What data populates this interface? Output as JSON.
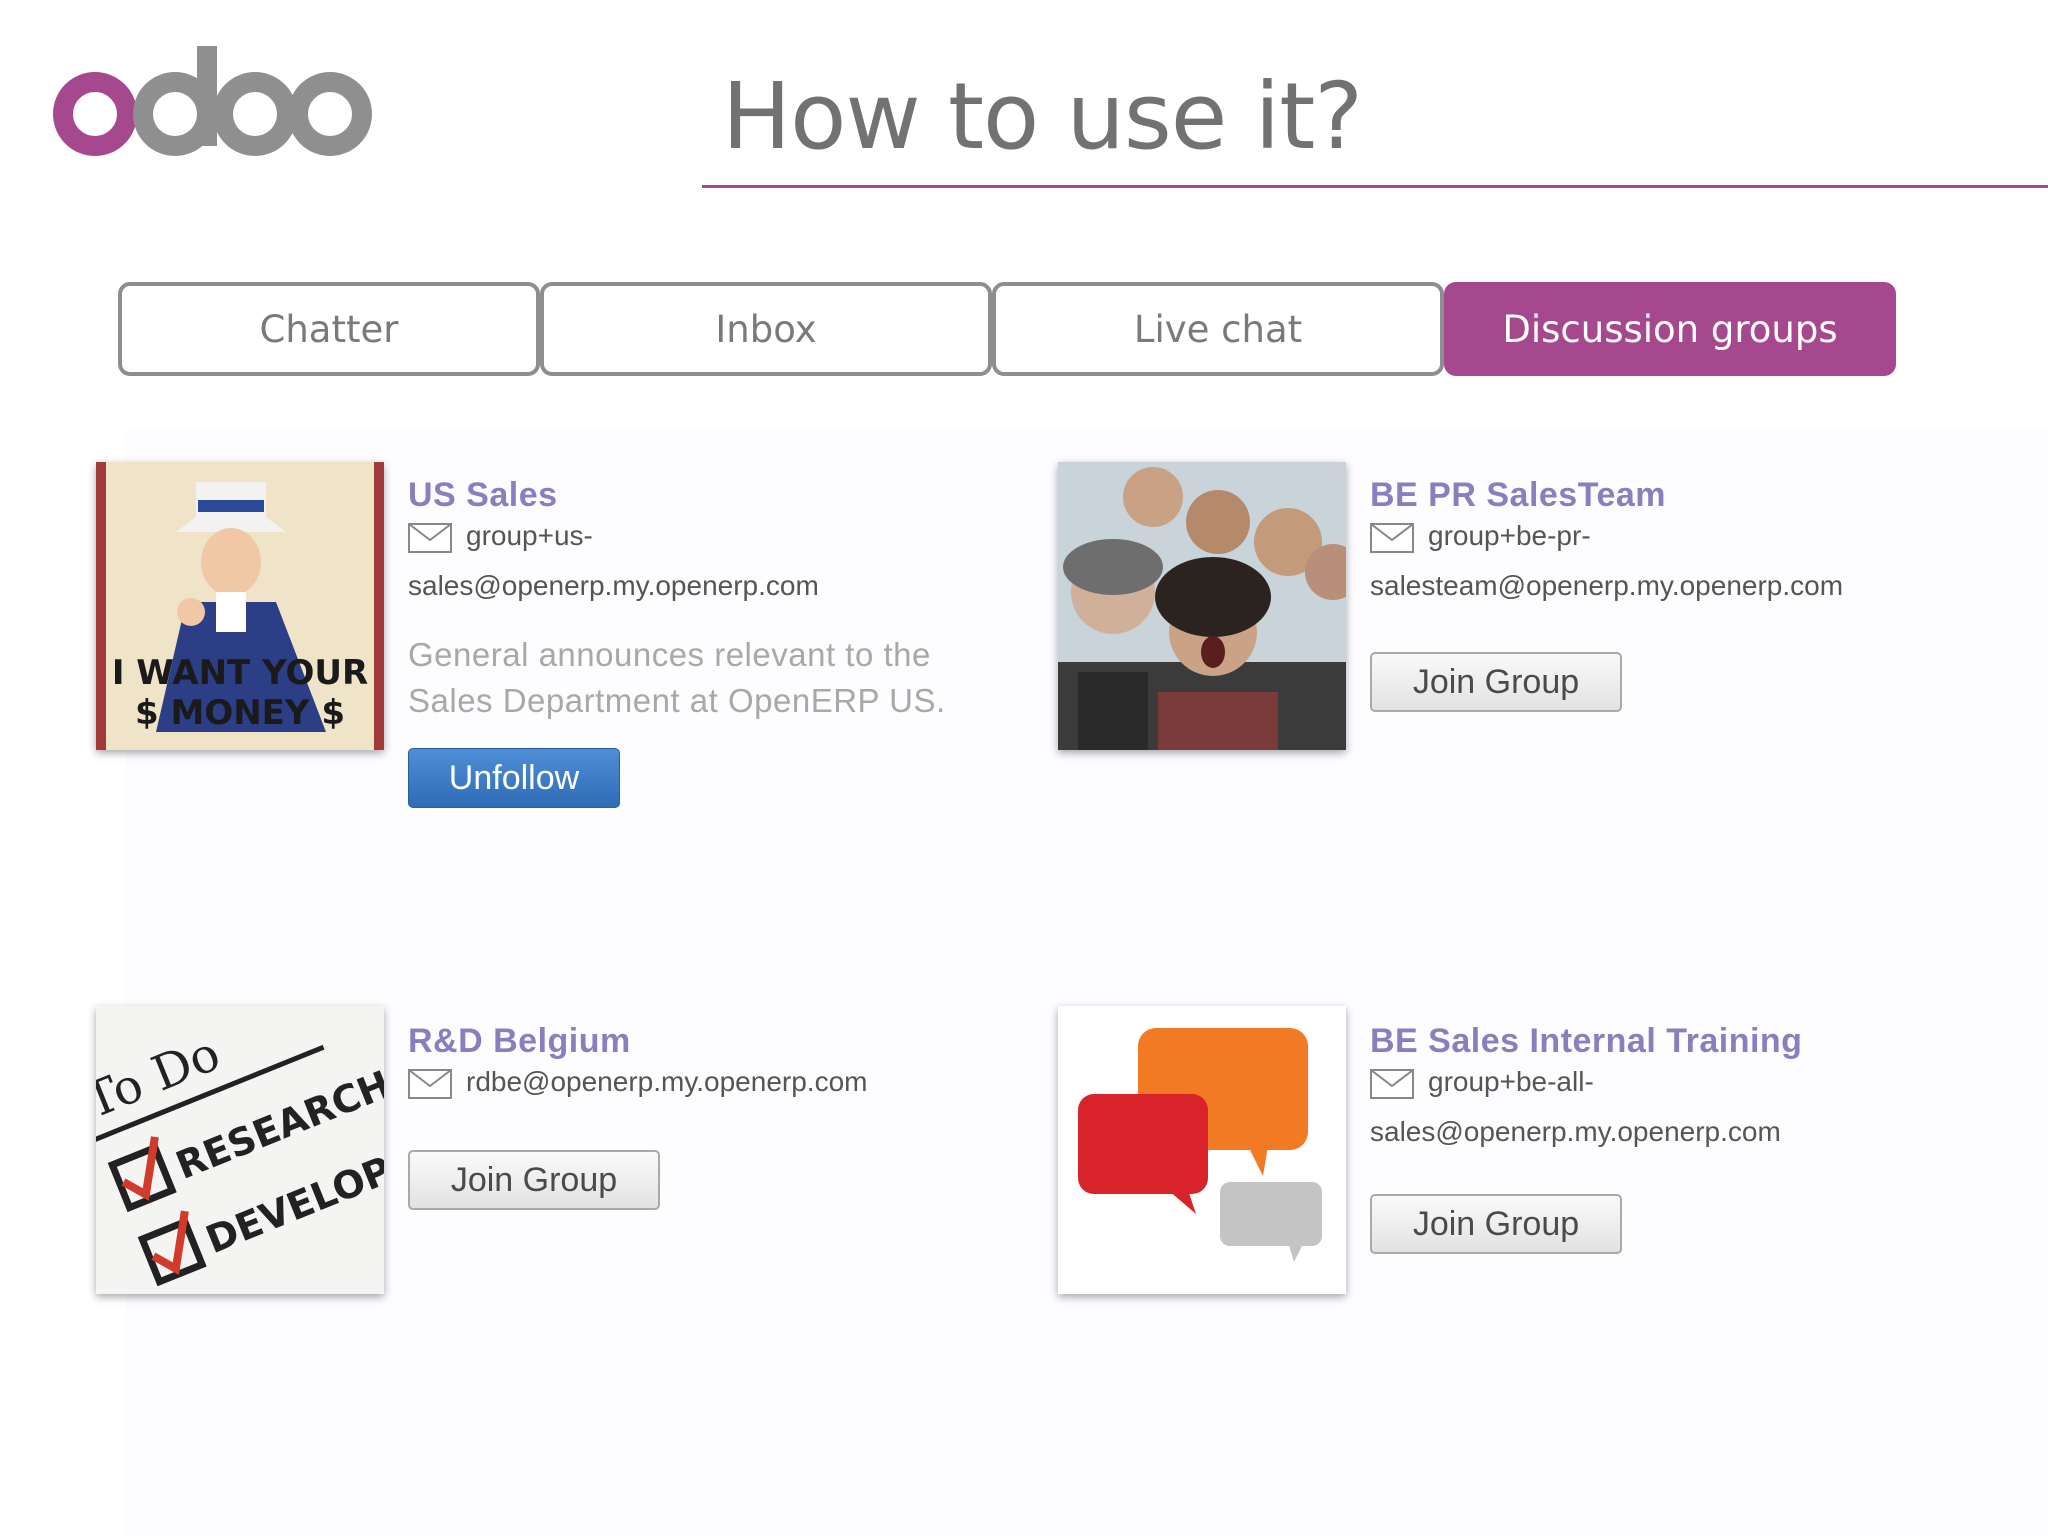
{
  "logo": {
    "text": "odoo",
    "accent_color": "#a5488d",
    "gray_color": "#8f8f8f"
  },
  "slide": {
    "title": "How to use it?",
    "rule_color": "#a5498f"
  },
  "tabs": [
    {
      "label": "Chatter",
      "active": false
    },
    {
      "label": "Inbox",
      "active": false
    },
    {
      "label": "Live chat",
      "active": false
    },
    {
      "label": "Discussion groups",
      "active": true
    }
  ],
  "groups": [
    {
      "name": "US Sales",
      "email_line1": "group+us-",
      "email_line2": "sales@openerp.my.openerp.com",
      "description": [
        "General announces relevant to the",
        "Sales Department at OpenERP US."
      ],
      "button": "Unfollow",
      "image_text": [
        "I WANT YOUR",
        "$ MONEY $"
      ]
    },
    {
      "name": "BE PR SalesTeam",
      "email_line1": "group+be-pr-",
      "email_line2": "salesteam@openerp.my.openerp.com",
      "button": "Join Group"
    },
    {
      "name": "R&D Belgium",
      "email_line1": "rdbe@openerp.my.openerp.com",
      "button": "Join Group",
      "image_text": [
        "To Do",
        "RESEARCH",
        "DEVELOP"
      ]
    },
    {
      "name": "BE Sales Internal Training",
      "email_line1": "group+be-all-",
      "email_line2": "sales@openerp.my.openerp.com",
      "button": "Join Group"
    }
  ],
  "icons": {
    "mail": "envelope-icon"
  }
}
